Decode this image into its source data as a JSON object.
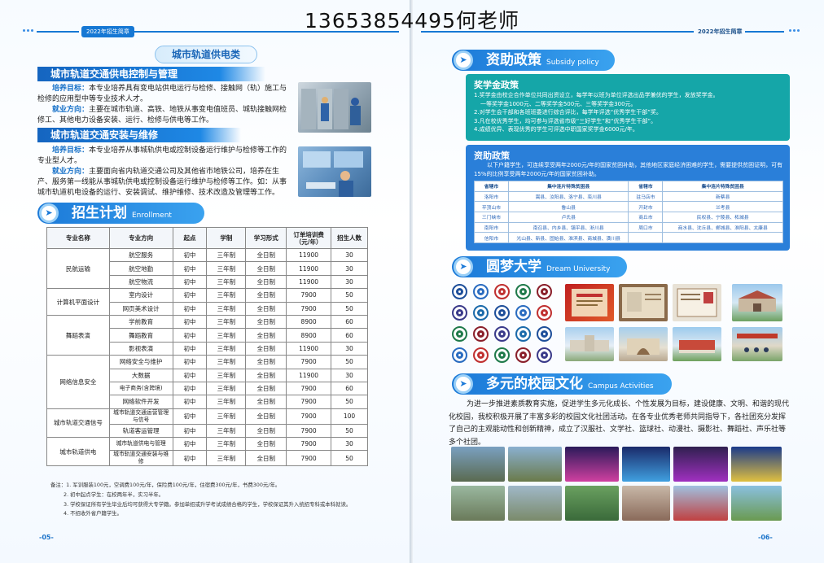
{
  "phone_header": "13653854495何老师",
  "left_page": {
    "badge": "2022年招生简章",
    "category_title": "城市轨道供电类",
    "majors": [
      {
        "tag": "城市轨道交通供电控制与管理",
        "goal_label": "培养目标：",
        "goal_text": "本专业培养具有变电站供电运行与检修、接触网（轨）施工与检修的应用型中等专业技术人才。",
        "job_label": "就业方向：",
        "job_text": "主要在城市轨道、高铁、地铁从事变电值班员、城轨接触网检修工、其他电力设备安装、运行、检修与供电等工作。"
      },
      {
        "tag": "城市轨道交通安装与维修",
        "goal_label": "培养目标：",
        "goal_text": "本专业培养从事城轨供电或控制设备运行维护与检修等工作的专业型人才。",
        "job_label": "就业方向：",
        "job_text": "主要面向省内轨道交通公司及其他省市地铁公司，培养在生产、服务第一线能从事城轨供电或控制设备运行维护与检修等工作。如：从事城市轨道机电设备的运行、安装调试、维护维修、技术改造及管理等工作。"
      }
    ],
    "enroll_title": "招生计划",
    "enroll_en": "Enrollment plan",
    "table_headers": [
      "专业名称",
      "专业方向",
      "起点",
      "学制",
      "学习形式",
      "订单培训费（元/年）",
      "招生人数"
    ],
    "table_groups": [
      {
        "name": "民航运输",
        "rows": [
          [
            "航空服务",
            "初中",
            "三年制",
            "全日制",
            "11900",
            "30"
          ],
          [
            "航空地勤",
            "初中",
            "三年制",
            "全日制",
            "11900",
            "30"
          ],
          [
            "航空物流",
            "初中",
            "三年制",
            "全日制",
            "11900",
            "30"
          ]
        ]
      },
      {
        "name": "计算机平面设计",
        "rows": [
          [
            "室内设计",
            "初中",
            "三年制",
            "全日制",
            "7900",
            "50"
          ],
          [
            "网页美术设计",
            "初中",
            "三年制",
            "全日制",
            "7900",
            "50"
          ]
        ]
      },
      {
        "name": "舞蹈表演",
        "rows": [
          [
            "学前教育",
            "初中",
            "三年制",
            "全日制",
            "8900",
            "60"
          ],
          [
            "舞蹈教育",
            "初中",
            "三年制",
            "全日制",
            "8900",
            "60"
          ],
          [
            "影视表演",
            "初中",
            "三年制",
            "全日制",
            "11900",
            "30"
          ]
        ]
      },
      {
        "name": "网络信息安全",
        "rows": [
          [
            "网络安全与维护",
            "初中",
            "三年制",
            "全日制",
            "7900",
            "50"
          ],
          [
            "大数据",
            "初中",
            "三年制",
            "全日制",
            "11900",
            "30"
          ],
          [
            "电子商务(含跨境)",
            "初中",
            "三年制",
            "全日制",
            "7900",
            "60"
          ],
          [
            "网络软件开发",
            "初中",
            "三年制",
            "全日制",
            "7900",
            "50"
          ]
        ]
      },
      {
        "name": "城市轨道交通信号",
        "rows": [
          [
            "城市轨道交通运营管理与信号",
            "初中",
            "三年制",
            "全日制",
            "7900",
            "100"
          ],
          [
            "轨道客运管理",
            "初中",
            "三年制",
            "全日制",
            "7900",
            "50"
          ]
        ]
      },
      {
        "name": "城市轨道供电",
        "rows": [
          [
            "城市轨道供电与管理",
            "初中",
            "三年制",
            "全日制",
            "7900",
            "30"
          ],
          [
            "城市轨道交通安装与维修",
            "初中",
            "三年制",
            "全日制",
            "7900",
            "50"
          ]
        ]
      }
    ],
    "notes": [
      "备注：1. 军训服装100元，空调费100元/年，保险费100元/年，住宿费300元/年，书费300元/年。",
      "2. 初中起点学生：在校两年半，实习半年。",
      "3. 学校保证所有学生毕业后均可获得大专学籍。参加单招或升学考试成绩合格的学生，学校保证其升入统招专科或本科就读。",
      "4. 不招收外省户籍学生。"
    ],
    "page_number": "-05-"
  },
  "right_page": {
    "badge": "2022年招生简章",
    "subsidy_title": "资助政策",
    "subsidy_en": "Subsidy policy",
    "scholarship": {
      "title": "奖学金政策",
      "lines": [
        "1.奖学金由校企合作单位共同出资设立，每学年以班为单位评选出品学兼优的学生，发放奖学金。",
        "一等奖学金1000元、二等奖学金500元、三等奖学金300元。",
        "2.对学生会干部和各班班委进行综合评比，每学年评选“优秀学生干部”奖。",
        "3.凡在校优秀学生，均可参与评选省市级“三好学生”和“优秀学生干部”。",
        "4.成绩优异、表现优秀的学生可评选中职国家奖学金6000元/年。"
      ]
    },
    "aid": {
      "title": "资助政策",
      "text": "以下户籍学生，可连续享受两年2000元/年的国家贫困补助，其他地区家庭经济困难的学生，需要提供贫困证明，可有15%的比例享受两年2000元/年的国家贫困补助。",
      "headers": [
        "省辖市",
        "集中连片特殊贫困县",
        "省辖市",
        "集中连片特殊贫困县"
      ],
      "rows": [
        [
          "洛阳市",
          "嵩县、汝阳县、洛宁县、栾川县",
          "驻马店市",
          "新蔡县"
        ],
        [
          "平顶山市",
          "鲁山县",
          "开封市",
          "兰考县"
        ],
        [
          "三门峡市",
          "卢氏县",
          "商丘市",
          "民权县、宁陵县、柘城县"
        ],
        [
          "南阳市",
          "南召县、内乡县、镇平县、淅川县",
          "周口市",
          "商水县、沈丘县、郸城县、淮阳县、太康县"
        ],
        [
          "信阳市",
          "光山县、新县、固始县、淮滨县、商城县、潢川县",
          "",
          ""
        ]
      ]
    },
    "dream_title": "圆梦大学",
    "dream_en": "Dream University",
    "campus_title": "多元的校园文化",
    "campus_en": "Campus Activities",
    "campus_text": "为进一步推进素质教育实施，促进学生多元化成长、个性发展为目标，建设健康、文明、和谐的现代化校园，我校积极开展了丰富多彩的校园文化社团活动。在各专业优秀老师共同指导下，各社团充分发挥了自己的主观能动性和创新精神，成立了汉服社、文学社、篮球社、动漫社、摄影社、舞蹈社、声乐社等多个社团。",
    "page_number": "-06-"
  },
  "colors": {
    "primary": "#1c7ad8",
    "teal": "#15a6a8",
    "aid_blue": "#2a7fd9"
  }
}
